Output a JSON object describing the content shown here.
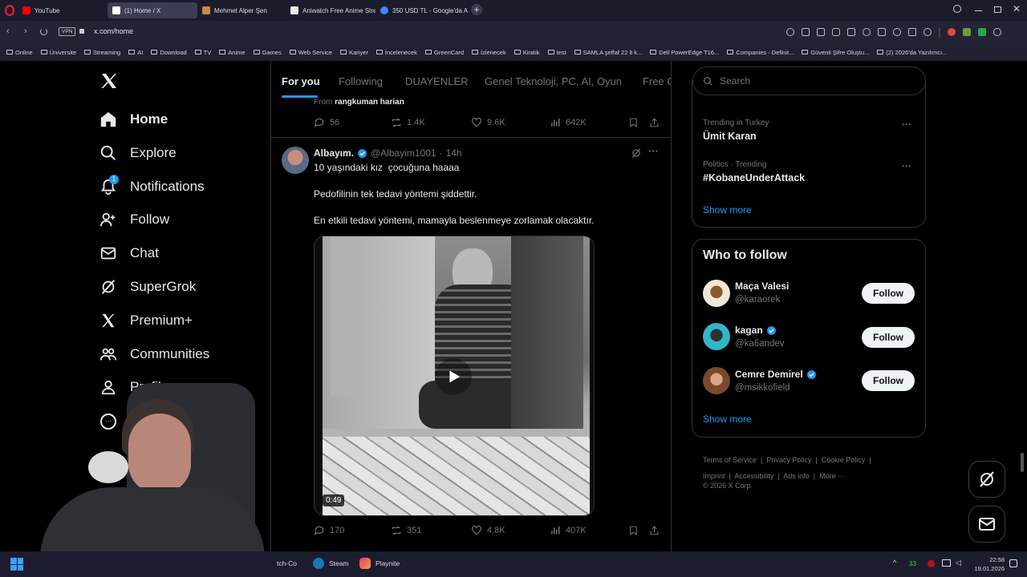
{
  "browser": {
    "tabs": [
      {
        "label": "YouTube",
        "color": "#ff0000"
      },
      {
        "label": "(1) Home / X",
        "color": "#ffffff"
      },
      {
        "label": "Mehmet Alper Şen",
        "color": "#c28b4a"
      },
      {
        "label": "Aniwatch Free Anime Stre",
        "color": "#ffffff"
      },
      {
        "label": "350 USD TL - Google'da A",
        "color": "#4285f4"
      }
    ],
    "url": "x.com/home",
    "vpn_label": "VPN",
    "bookmarks": [
      "Online",
      "Üniversite",
      "Streaming",
      "AI",
      "Download",
      "TV",
      "Anime",
      "Games",
      "Web Service",
      "Kariyer",
      "İncelenecek",
      "GreenCard",
      "İzlenecek",
      "Kiralık",
      "test",
      "SAMLA şeffaf 22 lt k...",
      "Dell PowerEdge T16...",
      "Companies - Definit...",
      "Güvenli Şifre Oluştu...",
      "(2) 2026'da Yazılımcı..."
    ]
  },
  "nav": {
    "items": [
      "Home",
      "Explore",
      "Notifications",
      "Follow",
      "Chat",
      "SuperGrok",
      "Premium+",
      "Communities",
      "Profile"
    ],
    "notif_count": "1"
  },
  "feed": {
    "tabs": [
      "For you",
      "Following",
      "DUAYENLER",
      "Genel Teknoloji, PC, AI, Oyun",
      "Free G"
    ],
    "prev_tweet": {
      "from_prefix": "From",
      "from_name": "rangkuman harian",
      "replies": "56",
      "reposts": "1.4K",
      "likes": "9.6K",
      "views": "642K"
    },
    "tweet": {
      "name": "Albayım.",
      "handle": "@Albayim1001",
      "time": "14h",
      "line1": "10 yaşındaki kız  çocuğuna haaaa",
      "line2": "Pedofilinin tek tedavi yöntemi şiddettir.",
      "line3": "En etkili tedavi yöntemi, mamayla beslenmeye zorlamak olacaktır.",
      "duration": "0:49",
      "replies": "170",
      "reposts": "351",
      "likes": "4.8K",
      "views": "407K"
    }
  },
  "right": {
    "search_placeholder": "Search",
    "trends": [
      {
        "context": "Trending in Turkey",
        "name": "Ümit Karan"
      },
      {
        "context": "Politics · Trending",
        "name": "#KobaneUnderAttack"
      }
    ],
    "show_more": "Show more",
    "who_title": "Who to follow",
    "who": [
      {
        "name": "Maça Valesi",
        "handle": "@karaorek",
        "verified": false
      },
      {
        "name": "kagan",
        "handle": "@ka6andev",
        "verified": true
      },
      {
        "name": "Cemre Demirel",
        "handle": "@msikkofield",
        "verified": true
      }
    ],
    "follow_label": "Follow",
    "footer": [
      "Terms of Service",
      "Privacy Policy",
      "Cookie Policy",
      "Imprint",
      "Accessibility",
      "Ads info",
      "More ···"
    ],
    "copyright": "© 2026 X Corp."
  },
  "taskbar": {
    "apps": [
      "tch-Co",
      "Steam",
      "Playnite"
    ],
    "tray_count": "33",
    "time": "22:58",
    "date": "19.01.2026"
  },
  "colors": {
    "accent": "#1d9bf0",
    "x_bg": "#000000",
    "muted": "#71767b"
  }
}
